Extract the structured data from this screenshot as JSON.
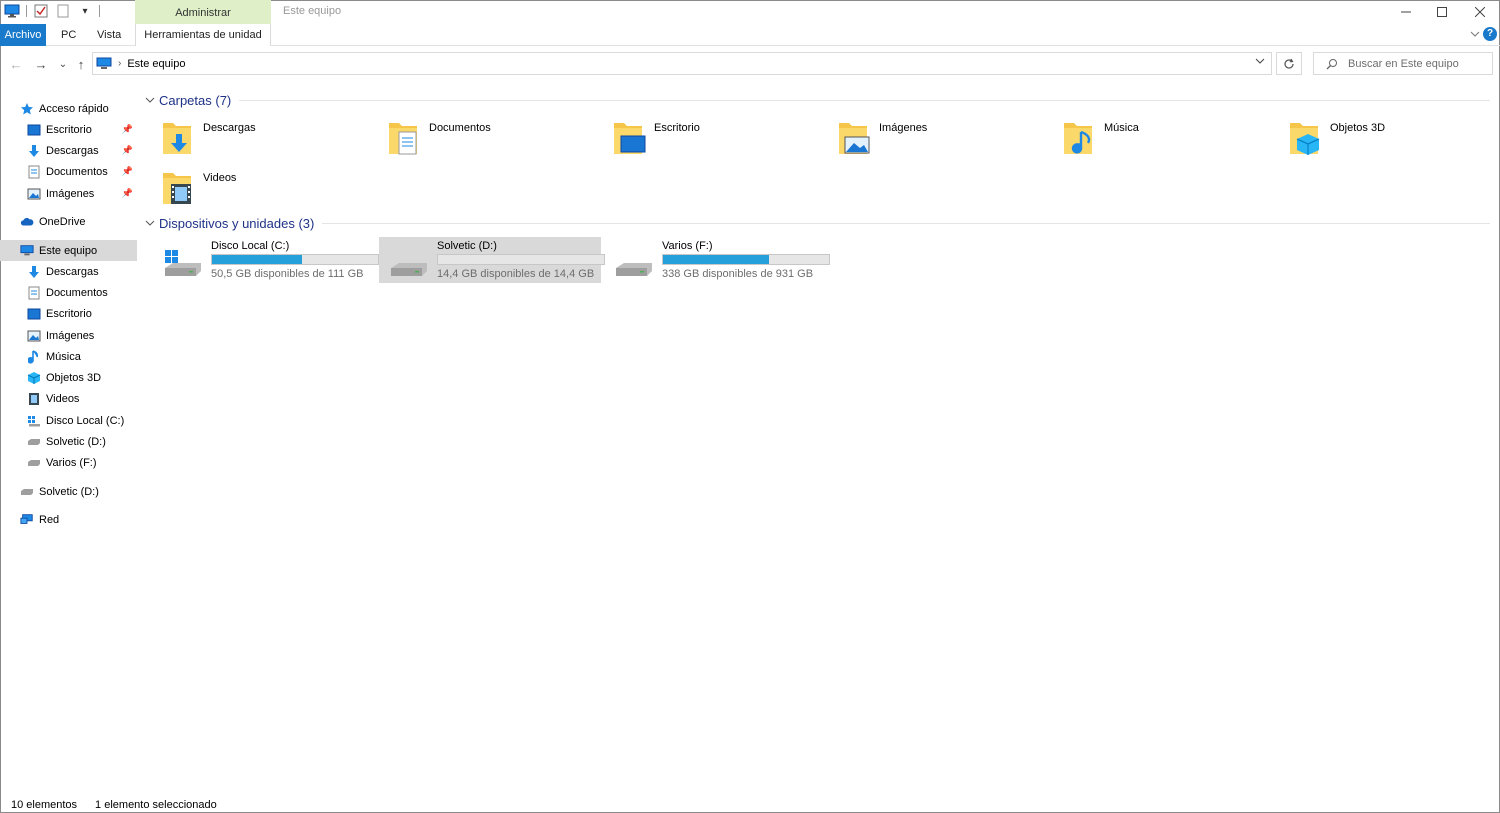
{
  "titlebar": {
    "context_tab": "Administrar",
    "title": "Este equipo",
    "qat_dropdown": "▾"
  },
  "ribbon": {
    "tabs": [
      {
        "label": "Archivo"
      },
      {
        "label": "PC"
      },
      {
        "label": "Vista"
      },
      {
        "label": "Herramientas de unidad"
      }
    ],
    "help": "?"
  },
  "navigation": {
    "back": "←",
    "forward": "→",
    "recent": "⌄",
    "up": "↑"
  },
  "address": {
    "path": "Este equipo",
    "separator": "›"
  },
  "search": {
    "placeholder": "Buscar en Este equipo"
  },
  "sidebar": {
    "quick_access": "Acceso rápido",
    "quick_items": [
      {
        "label": "Escritorio"
      },
      {
        "label": "Descargas"
      },
      {
        "label": "Documentos"
      },
      {
        "label": "Imágenes"
      }
    ],
    "onedrive": "OneDrive",
    "this_pc": "Este equipo",
    "pc_items": [
      {
        "label": "Descargas"
      },
      {
        "label": "Documentos"
      },
      {
        "label": "Escritorio"
      },
      {
        "label": "Imágenes"
      },
      {
        "label": "Música"
      },
      {
        "label": "Objetos 3D"
      },
      {
        "label": "Videos"
      },
      {
        "label": "Disco Local (C:)"
      },
      {
        "label": "Solvetic (D:)"
      },
      {
        "label": "Varios (F:)"
      }
    ],
    "removable": "Solvetic (D:)",
    "network": "Red"
  },
  "folders_group": {
    "title": "Carpetas (7)",
    "items": [
      {
        "label": "Descargas",
        "icon": "downloads-folder-icon"
      },
      {
        "label": "Documentos",
        "icon": "documents-folder-icon"
      },
      {
        "label": "Escritorio",
        "icon": "desktop-folder-icon"
      },
      {
        "label": "Imágenes",
        "icon": "pictures-folder-icon"
      },
      {
        "label": "Música",
        "icon": "music-folder-icon"
      },
      {
        "label": "Objetos 3D",
        "icon": "3d-objects-folder-icon"
      },
      {
        "label": "Videos",
        "icon": "videos-folder-icon"
      }
    ]
  },
  "drives_group": {
    "title": "Dispositivos y unidades (3)",
    "items": [
      {
        "label": "Disco Local (C:)",
        "info": "50,5 GB disponibles de 111 GB",
        "used_fraction": 0.545,
        "selected": false
      },
      {
        "label": "Solvetic (D:)",
        "info": "14,4 GB disponibles de 14,4 GB",
        "used_fraction": 0.0,
        "selected": true
      },
      {
        "label": "Varios (F:)",
        "info": "338 GB disponibles de 931 GB",
        "used_fraction": 0.637,
        "selected": false
      }
    ]
  },
  "status": {
    "count": "10 elementos",
    "selection": "1 elemento seleccionado"
  },
  "colors": {
    "accent": "#1979ca",
    "drive_bar": "#26a0da",
    "folder_yellow": "#f6c64a",
    "group_header": "#1e3287"
  }
}
